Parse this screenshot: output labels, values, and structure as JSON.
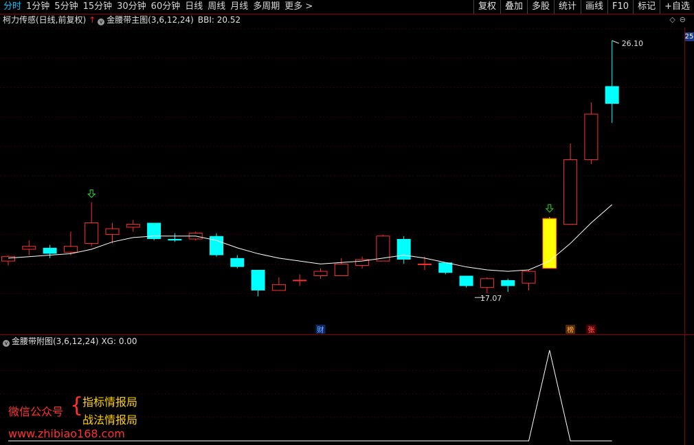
{
  "topbar": {
    "menu": [
      "分时",
      "1分钟",
      "5分钟",
      "15分钟",
      "30分钟",
      "60分钟",
      "日线",
      "周线",
      "月线",
      "多周期",
      "更多 >"
    ],
    "active_index": 0,
    "right_buttons": [
      "复权",
      "叠加",
      "多股",
      "统计",
      "画线",
      "F10",
      "标记",
      "+自选"
    ]
  },
  "main_info": {
    "stock_name": "柯力传感(日线,前复权)",
    "up_arrow": "↑",
    "indicator": "金腰带主图(3,6,12,24)",
    "bbi": "BBI: 20.52"
  },
  "main_icons": [
    "◇",
    "⊖"
  ],
  "price_badge": "25",
  "sub_info": {
    "indicator": "金腰带附图(3,6,12,24)",
    "xg": "XG: 0.00"
  },
  "annotations": {
    "high_label": "26.10",
    "low_label": "17.07",
    "cai": "财",
    "bang": "榜",
    "zhang": "张"
  },
  "watermark": {
    "wechat": "微信公众号",
    "line1": "指标情报局",
    "line2": "战法情报局",
    "url": "www.zhibiao168.com"
  },
  "colors": {
    "up": "#ff3030",
    "down": "#00ffff",
    "signal": "#ffff00",
    "bbi_line": "#ffffff",
    "menu_active": "#00c8ff",
    "grid": "#3a0000"
  },
  "chart_data": {
    "type": "candlestick",
    "price_range": [
      16.5,
      26.5
    ],
    "candles": [
      {
        "o": 18.6,
        "h": 18.8,
        "l": 18.45,
        "c": 18.75
      },
      {
        "o": 19.0,
        "h": 19.3,
        "l": 18.8,
        "c": 19.1
      },
      {
        "o": 19.05,
        "h": 19.15,
        "l": 18.7,
        "c": 18.85
      },
      {
        "o": 18.9,
        "h": 19.6,
        "l": 18.8,
        "c": 19.1
      },
      {
        "o": 19.2,
        "h": 20.6,
        "l": 19.1,
        "c": 19.9
      },
      {
        "o": 19.5,
        "h": 19.9,
        "l": 19.2,
        "c": 19.7
      },
      {
        "o": 19.75,
        "h": 20.0,
        "l": 19.6,
        "c": 19.85
      },
      {
        "o": 19.9,
        "h": 19.9,
        "l": 19.3,
        "c": 19.35
      },
      {
        "o": 19.35,
        "h": 19.55,
        "l": 19.25,
        "c": 19.3
      },
      {
        "o": 19.35,
        "h": 19.6,
        "l": 19.3,
        "c": 19.55
      },
      {
        "o": 19.45,
        "h": 19.55,
        "l": 18.75,
        "c": 18.8
      },
      {
        "o": 18.7,
        "h": 18.8,
        "l": 18.35,
        "c": 18.4
      },
      {
        "o": 18.3,
        "h": 18.3,
        "l": 17.4,
        "c": 17.6
      },
      {
        "o": 17.6,
        "h": 18.05,
        "l": 17.6,
        "c": 17.8
      },
      {
        "o": 17.95,
        "h": 18.15,
        "l": 17.75,
        "c": 17.95
      },
      {
        "o": 18.1,
        "h": 18.35,
        "l": 18.0,
        "c": 18.25
      },
      {
        "o": 18.1,
        "h": 18.7,
        "l": 18.1,
        "c": 18.5
      },
      {
        "o": 18.45,
        "h": 18.75,
        "l": 18.35,
        "c": 18.65
      },
      {
        "o": 18.6,
        "h": 19.5,
        "l": 18.6,
        "c": 19.45
      },
      {
        "o": 19.35,
        "h": 19.45,
        "l": 18.5,
        "c": 18.65
      },
      {
        "o": 18.5,
        "h": 18.75,
        "l": 18.3,
        "c": 18.5
      },
      {
        "o": 18.55,
        "h": 18.55,
        "l": 18.15,
        "c": 18.2
      },
      {
        "o": 18.1,
        "h": 18.1,
        "l": 17.7,
        "c": 17.75
      },
      {
        "o": 17.7,
        "h": 18.05,
        "l": 17.5,
        "c": 18.0
      },
      {
        "o": 17.95,
        "h": 18.0,
        "l": 17.55,
        "c": 17.75
      },
      {
        "o": 17.85,
        "h": 18.3,
        "l": 17.6,
        "c": 18.25
      },
      {
        "o": 18.35,
        "h": 20.1,
        "l": 18.35,
        "c": 20.05
      },
      {
        "o": 19.85,
        "h": 22.6,
        "l": 19.85,
        "c": 22.05
      },
      {
        "o": 22.05,
        "h": 24.0,
        "l": 21.9,
        "c": 23.6
      },
      {
        "o": 24.55,
        "h": 26.1,
        "l": 23.3,
        "c": 23.95
      }
    ],
    "signal_candle_index": 26,
    "arrow_indices": [
      4,
      26
    ],
    "bbi": [
      18.7,
      18.75,
      18.8,
      18.85,
      19.0,
      19.25,
      19.4,
      19.45,
      19.45,
      19.45,
      19.3,
      19.05,
      18.85,
      18.7,
      18.6,
      18.5,
      18.55,
      18.6,
      18.7,
      18.8,
      18.7,
      18.55,
      18.4,
      18.3,
      18.25,
      18.3,
      18.6,
      19.2,
      19.9,
      20.52
    ],
    "xg": [
      0,
      0,
      0,
      0,
      0,
      0,
      0,
      0,
      0,
      0,
      0,
      0,
      0,
      0,
      0,
      0,
      0,
      0,
      0,
      0,
      0,
      0,
      0,
      0,
      0,
      0,
      1,
      0,
      0,
      0
    ],
    "high_index": 29,
    "low_index": 23,
    "cai_index": 15,
    "bang_index": 27,
    "zhang_index": 28
  }
}
